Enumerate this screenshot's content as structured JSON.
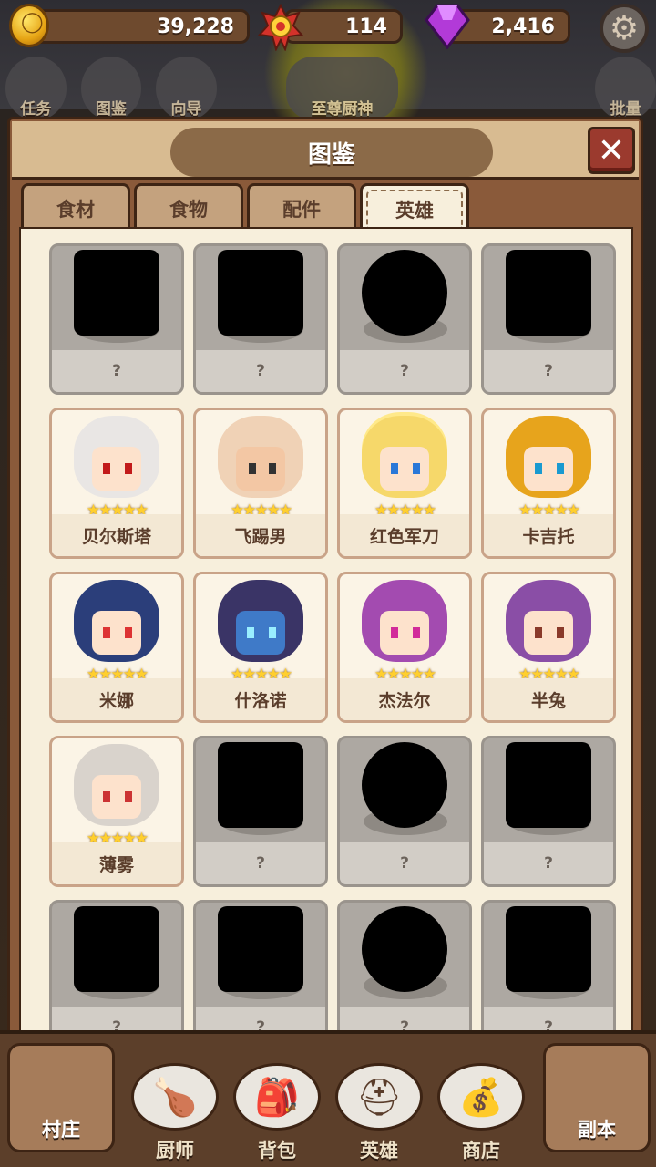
{
  "currency": {
    "coins": "39,228",
    "medals": "114",
    "gems": "2,416"
  },
  "background_menu": [
    "任务",
    "图鉴",
    "向导",
    "至尊厨神",
    "批量"
  ],
  "panel": {
    "title": "图鉴",
    "close_label": "✕"
  },
  "tabs": [
    {
      "label": "食材",
      "active": false
    },
    {
      "label": "食物",
      "active": false
    },
    {
      "label": "配件",
      "active": false
    },
    {
      "label": "英雄",
      "active": true
    }
  ],
  "heroes": [
    {
      "name": "?",
      "locked": true
    },
    {
      "name": "?",
      "locked": true
    },
    {
      "name": "?",
      "locked": true
    },
    {
      "name": "?",
      "locked": true
    },
    {
      "name": "贝尔斯塔",
      "locked": false,
      "stars": 5
    },
    {
      "name": "飞踢男",
      "locked": false,
      "stars": 5
    },
    {
      "name": "红色军刀",
      "locked": false,
      "stars": 5
    },
    {
      "name": "卡吉托",
      "locked": false,
      "stars": 5
    },
    {
      "name": "米娜",
      "locked": false,
      "stars": 5
    },
    {
      "name": "什洛诺",
      "locked": false,
      "stars": 5
    },
    {
      "name": "杰法尔",
      "locked": false,
      "stars": 5
    },
    {
      "name": "半兔",
      "locked": false,
      "stars": 5
    },
    {
      "name": "薄雾",
      "locked": false,
      "stars": 5
    },
    {
      "name": "?",
      "locked": true
    },
    {
      "name": "?",
      "locked": true
    },
    {
      "name": "?",
      "locked": true
    },
    {
      "name": "?",
      "locked": true
    },
    {
      "name": "?",
      "locked": true
    },
    {
      "name": "?",
      "locked": true
    },
    {
      "name": "?",
      "locked": true
    }
  ],
  "stars_glyph": "★★★★★",
  "bottom_nav": {
    "left": "村庄",
    "items": [
      "厨师",
      "背包",
      "英雄",
      "商店"
    ],
    "right": "副本"
  }
}
